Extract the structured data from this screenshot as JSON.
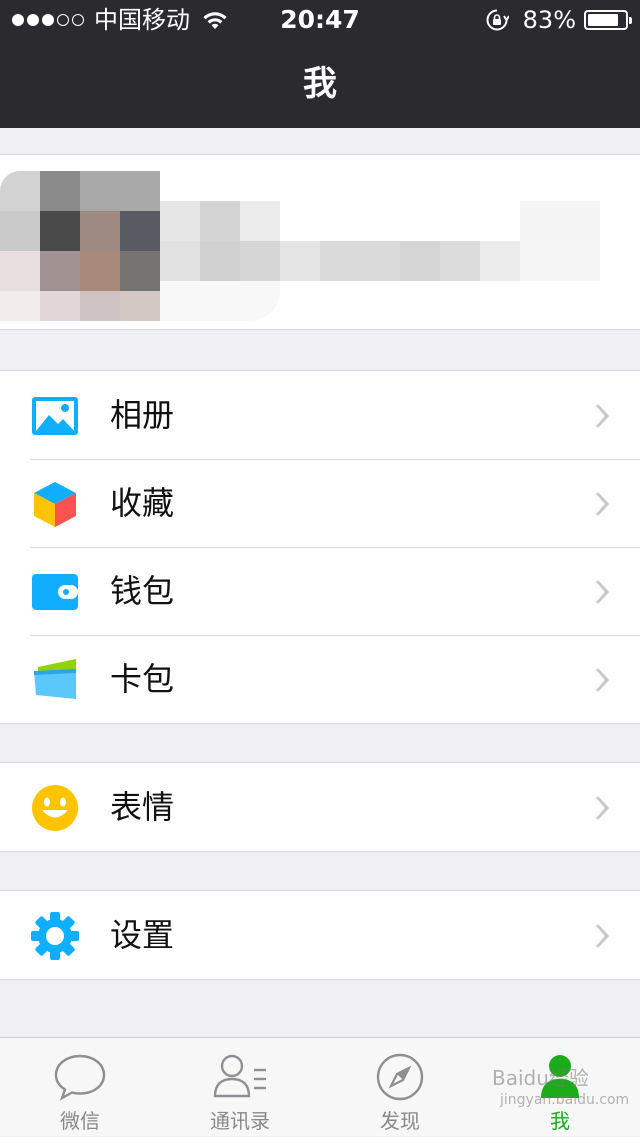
{
  "status_bar": {
    "carrier": "中国移动",
    "time": "20:47",
    "battery_percent": "83%",
    "battery_level": 0.83,
    "signal_bars_filled": 3,
    "signal_bars_total": 5
  },
  "nav": {
    "title": "我"
  },
  "groups": [
    {
      "items": [
        {
          "label": "相册",
          "icon": "photo-album-icon"
        },
        {
          "label": "收藏",
          "icon": "favorites-cube-icon"
        },
        {
          "label": "钱包",
          "icon": "wallet-icon"
        },
        {
          "label": "卡包",
          "icon": "card-pack-icon"
        }
      ]
    },
    {
      "items": [
        {
          "label": "表情",
          "icon": "smiley-icon"
        }
      ]
    },
    {
      "items": [
        {
          "label": "设置",
          "icon": "gear-icon"
        }
      ]
    }
  ],
  "tabbar": {
    "tabs": [
      {
        "label": "微信",
        "icon": "chat-bubble-icon",
        "active": false
      },
      {
        "label": "通讯录",
        "icon": "contacts-icon",
        "active": false
      },
      {
        "label": "发现",
        "icon": "compass-icon",
        "active": false
      },
      {
        "label": "我",
        "icon": "me-person-icon",
        "active": true
      }
    ]
  },
  "watermark": {
    "text": "Baidu经验",
    "sub": "jingyan.baidu.com"
  },
  "colors": {
    "header_bg": "#2b2b2f",
    "page_bg": "#efeff4",
    "accent_green": "#1aad19",
    "icon_blue": "#10aeff"
  }
}
